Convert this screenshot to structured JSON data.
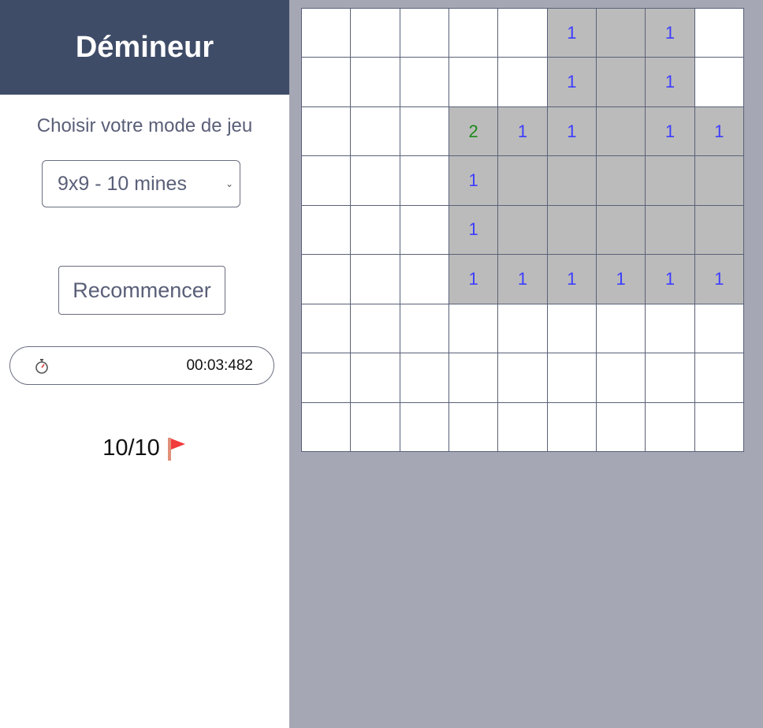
{
  "app": {
    "title": "Démineur"
  },
  "controls": {
    "mode_label": "Choisir votre mode de jeu",
    "mode_selected": "9x9 - 10 mines",
    "restart_label": "Recommencer"
  },
  "timer": {
    "value": "00:03:482",
    "icon": "stopwatch-icon"
  },
  "flags": {
    "count": "10/10",
    "icon": "flag-icon"
  },
  "colors": {
    "header": "#3f4c68",
    "revealed": "#bbbbbb",
    "unrevealed": "#ffffff",
    "number_1": "#3d3dff",
    "number_2": "#1a8a1a"
  },
  "board": {
    "rows": 9,
    "cols": 9,
    "legend": "U = unrevealed, E = revealed empty, digits = revealed number",
    "cells": [
      [
        "U",
        "U",
        "U",
        "U",
        "U",
        "1",
        "E",
        "1",
        "U"
      ],
      [
        "U",
        "U",
        "U",
        "U",
        "U",
        "1",
        "E",
        "1",
        "U"
      ],
      [
        "U",
        "U",
        "U",
        "2",
        "1",
        "1",
        "E",
        "1",
        "1"
      ],
      [
        "U",
        "U",
        "U",
        "1",
        "E",
        "E",
        "E",
        "E",
        "E"
      ],
      [
        "U",
        "U",
        "U",
        "1",
        "E",
        "E",
        "E",
        "E",
        "E"
      ],
      [
        "U",
        "U",
        "U",
        "1",
        "1",
        "1",
        "1",
        "1",
        "1"
      ],
      [
        "U",
        "U",
        "U",
        "U",
        "U",
        "U",
        "U",
        "U",
        "U"
      ],
      [
        "U",
        "U",
        "U",
        "U",
        "U",
        "U",
        "U",
        "U",
        "U"
      ],
      [
        "U",
        "U",
        "U",
        "U",
        "U",
        "U",
        "U",
        "U",
        "U"
      ]
    ]
  }
}
